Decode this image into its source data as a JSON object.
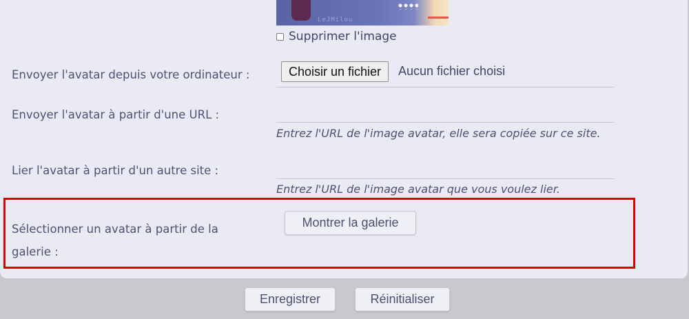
{
  "avatar": {
    "watermark": "LeJMilou",
    "delete_label": "Supprimer l'image"
  },
  "upload": {
    "label": "Envoyer l'avatar depuis votre ordinateur :",
    "choose_button": "Choisir un fichier",
    "status": "Aucun fichier choisi"
  },
  "url_upload": {
    "label": "Envoyer l'avatar à partir d'une URL :",
    "value": "",
    "hint": "Entrez l'URL de l'image avatar, elle sera copiée sur ce site."
  },
  "link": {
    "label": "Lier l'avatar à partir d'un autre site :",
    "value": "",
    "hint": "Entrez l'URL de l'image avatar que vous voulez lier."
  },
  "gallery": {
    "label": "Sélectionner un avatar à partir de la galerie :",
    "button": "Montrer la galerie"
  },
  "actions": {
    "save": "Enregistrer",
    "reset": "Réinitialiser"
  },
  "colors": {
    "panel_bg": "#eaeaf4",
    "page_bg": "#c9c8ce",
    "highlight": "#e00000",
    "text": "#4c5270"
  }
}
